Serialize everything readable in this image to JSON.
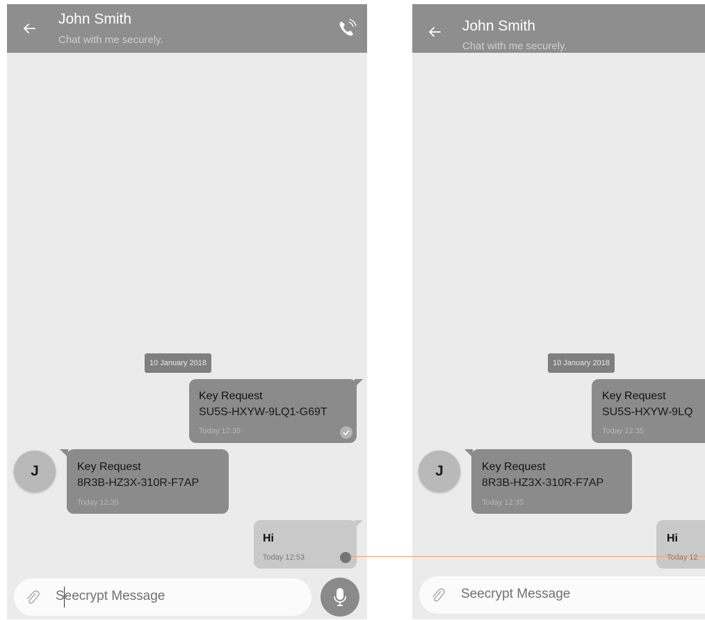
{
  "header": {
    "contact_name": "John Smith",
    "status": "Chat with me securely."
  },
  "thread": {
    "date_label": "10 January 2018",
    "messages": [
      {
        "direction": "outgoing",
        "title": "Key Request",
        "body": "SU5S-HXYW-9LQ1-G69T",
        "time": "Today 12:35",
        "status": "delivered"
      },
      {
        "direction": "incoming",
        "title": "Key Request",
        "body": "8R3B-HZ3X-310R-F7AP",
        "time": "Today 12:35"
      },
      {
        "direction": "outgoing",
        "title": "Hi",
        "time": "Today 12:53",
        "status": "pending"
      }
    ],
    "avatar_initial": "J"
  },
  "right_thread": {
    "outgoing_key_truncated": "SU5S-HXYW-9LQ",
    "hi_time_truncated": "Today 12"
  },
  "composer": {
    "placeholder": "Seecrypt Message"
  },
  "icons": {
    "back": "arrow-back-icon",
    "call": "phone-call-icon",
    "attach": "paperclip-icon",
    "mic": "microphone-icon",
    "sent_check": "check-circle-icon",
    "pending": "pending-dot-icon"
  },
  "colors": {
    "app_bar": "#8e8e8e",
    "chat_background": "#ebebeb",
    "bubble_dark": "#8b8b8b",
    "bubble_light": "#c9c9c9",
    "annotation_line": "#e7a36d"
  }
}
